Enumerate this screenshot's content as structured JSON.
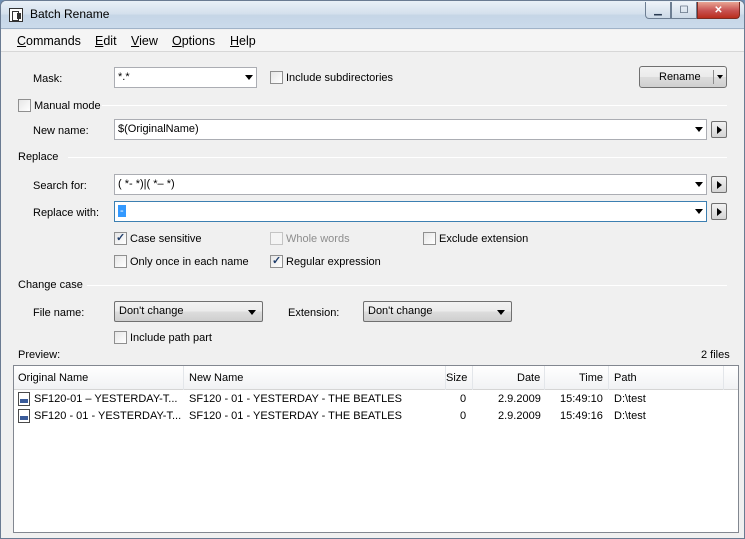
{
  "window": {
    "title": "Batch Rename"
  },
  "menu": [
    {
      "pre": "",
      "u": "C",
      "post": "ommands"
    },
    {
      "pre": "",
      "u": "E",
      "post": "dit"
    },
    {
      "pre": "",
      "u": "V",
      "post": "iew"
    },
    {
      "pre": "",
      "u": "O",
      "post": "ptions"
    },
    {
      "pre": "",
      "u": "H",
      "post": "elp"
    }
  ],
  "mask": {
    "label": "Mask:",
    "value": "*.*"
  },
  "include_subdirectories": {
    "label": "Include subdirectories",
    "checked": false
  },
  "rename_button": {
    "label": "Rename"
  },
  "manual_mode": {
    "label": "Manual mode",
    "checked": false
  },
  "new_name": {
    "label": "New name:",
    "value": "$(OriginalName)"
  },
  "replace": {
    "group_label": "Replace",
    "search_label": "Search for:",
    "search_value": "( *- *)|( *– *)",
    "replace_label": "Replace with:",
    "replace_value": "-"
  },
  "options": {
    "case_sensitive": {
      "label": "Case sensitive",
      "checked": true
    },
    "whole_words": {
      "label": "Whole words",
      "checked": false,
      "disabled": true
    },
    "exclude_extension": {
      "label": "Exclude extension",
      "checked": false
    },
    "only_once": {
      "label": "Only once in each name",
      "checked": false
    },
    "regular_expression": {
      "label": "Regular expression",
      "checked": true
    }
  },
  "change_case": {
    "group_label": "Change case",
    "file_name_label": "File name:",
    "file_name_value": "Don't change",
    "extension_label": "Extension:",
    "extension_value": "Don't change",
    "include_path_part": {
      "label": "Include path part",
      "checked": false
    }
  },
  "preview": {
    "label": "Preview:",
    "count": "2 files",
    "columns": [
      "Original Name",
      "New Name",
      "Size",
      "Date",
      "Time",
      "Path"
    ],
    "rows": [
      {
        "original": "SF120-01 – YESTERDAY-T...",
        "new": "SF120 - 01 - YESTERDAY - THE BEATLES",
        "size": "0",
        "date": "2.9.2009",
        "time": "15:49:10",
        "path": "D:\\test"
      },
      {
        "original": "SF120 - 01 - YESTERDAY-T...",
        "new": "SF120 - 01 - YESTERDAY - THE BEATLES",
        "size": "0",
        "date": "2.9.2009",
        "time": "15:49:16",
        "path": "D:\\test"
      }
    ]
  }
}
